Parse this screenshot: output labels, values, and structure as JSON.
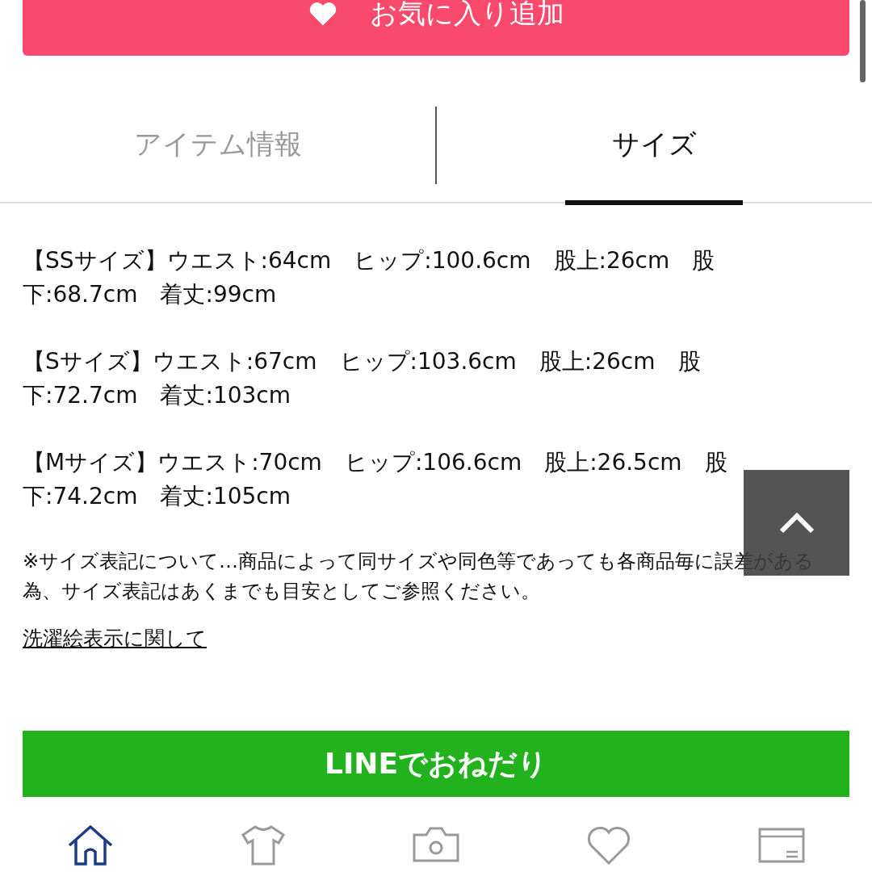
{
  "favorite_button": {
    "label": "お気に入り追加"
  },
  "tabs": [
    {
      "label": "アイテム情報",
      "selected": false
    },
    {
      "label": "サイズ",
      "selected": true
    }
  ],
  "sizes": [
    "【SSサイズ】ウエスト:64cm　ヒップ:100.6cm　股上:26cm　股下:68.7cm　着丈:99cm",
    "【Sサイズ】ウエスト:67cm　ヒップ:103.6cm　股上:26cm　股下:72.7cm　着丈:103cm",
    "【Mサイズ】ウエスト:70cm　ヒップ:106.6cm　股上:26.5cm　股下:74.2cm　着丈:105cm"
  ],
  "note": "※サイズ表記について…商品によって同サイズや同色等であっても各商品毎に誤差がある為、サイズ表記はあくまでも目安としてご参照ください。",
  "care_link": "洗濯絵表示に関して",
  "line_button": {
    "label": "LINEでおねだり"
  },
  "nav": [
    {
      "kind": "home",
      "selected": true
    },
    {
      "kind": "item",
      "selected": false
    },
    {
      "kind": "snap",
      "selected": false
    },
    {
      "kind": "favorite",
      "selected": false
    },
    {
      "kind": "members",
      "selected": false
    }
  ]
}
